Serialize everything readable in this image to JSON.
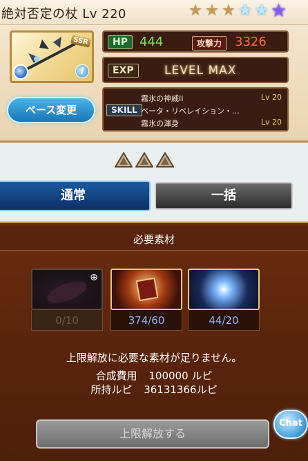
{
  "weapon": {
    "name": "絶対否定の杖 Lv 220",
    "rarity": "SSR",
    "stars": [
      "bronze",
      "bronze",
      "bronze",
      "blue",
      "blue",
      "purple"
    ]
  },
  "stats": {
    "hp_label": "HP",
    "hp_value": "444",
    "atk_label": "攻撃力",
    "atk_value": "3326",
    "exp_label": "EXP",
    "exp_status": "LEVEL MAX"
  },
  "skill": {
    "label": "SKILL",
    "items": [
      {
        "name": "霧氷の神威II",
        "lv": "Lv 20"
      },
      {
        "name": "ベータ・リベレイション・…",
        "lv": ""
      },
      {
        "name": "霧氷の渾身",
        "lv": "Lv 20"
      }
    ]
  },
  "base_button": "ベース変更",
  "tabs": {
    "normal": "通常",
    "bulk": "一括"
  },
  "materials": {
    "title": "必要素材",
    "items": [
      {
        "count": "0/10",
        "state": "insufficient"
      },
      {
        "count": "374/60",
        "state": "ok"
      },
      {
        "count": "44/20",
        "state": "ok"
      }
    ]
  },
  "message": "上限解放に必要な素材が足りません。",
  "cost": {
    "label": "合成費用",
    "value": "100000 ルピ"
  },
  "owned": {
    "label": "所持ルピ",
    "value": "36131366ルピ"
  },
  "limit_button": "上限解放する",
  "chat_button": "Chat",
  "colors": {
    "hp": "#7fe35a",
    "atk": "#ff6a3a",
    "panel": "#5a240c"
  }
}
